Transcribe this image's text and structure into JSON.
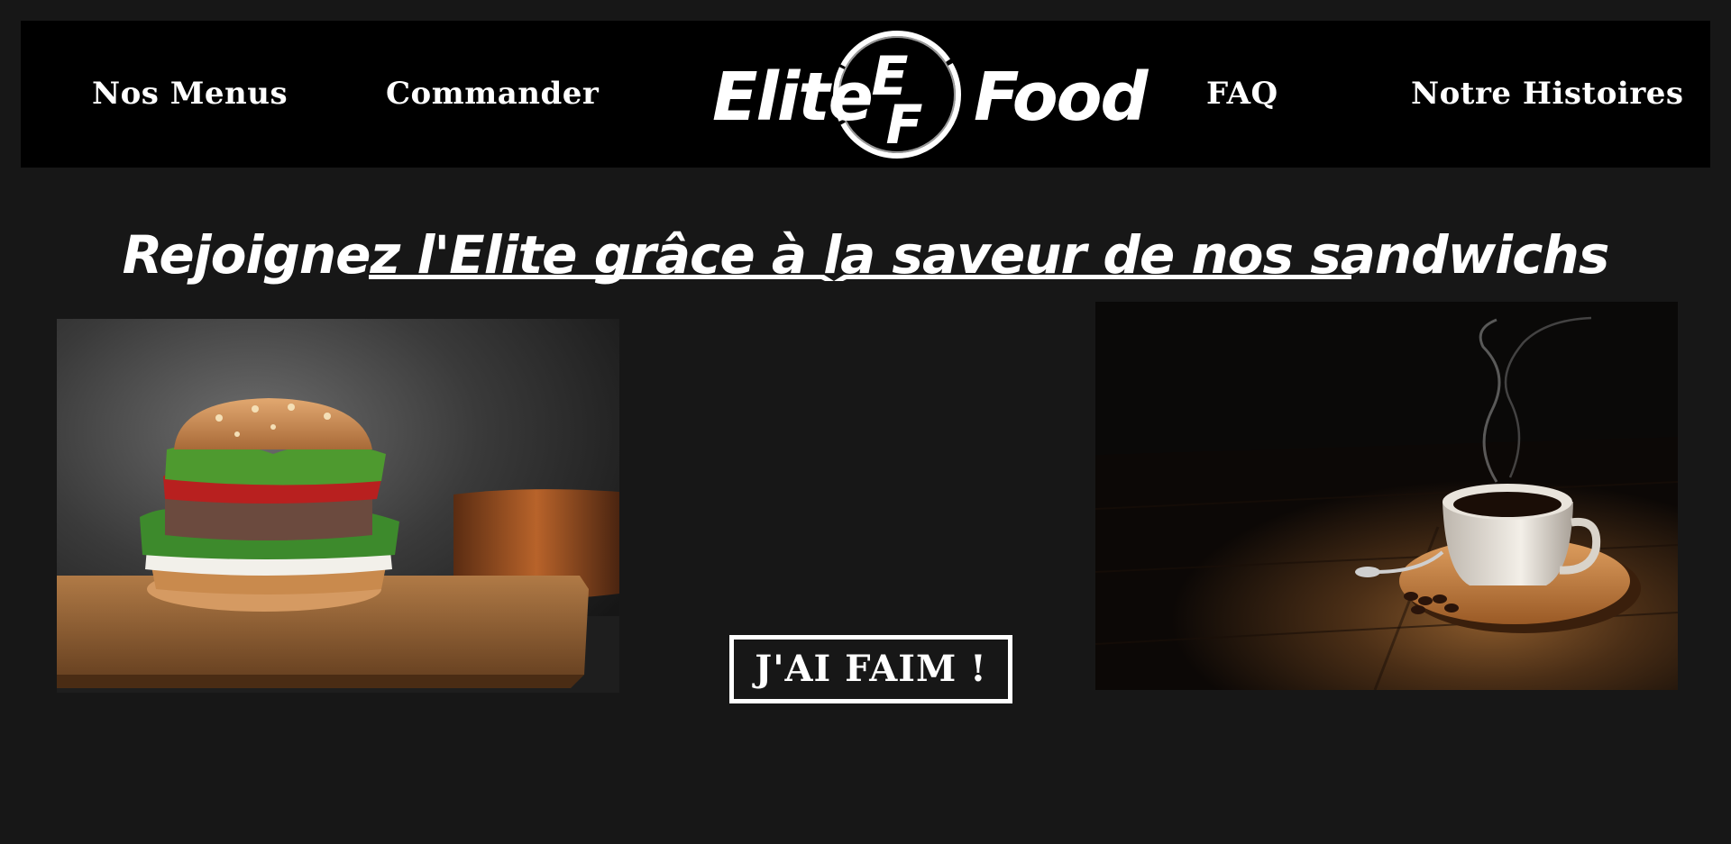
{
  "nav": {
    "items": [
      {
        "label": "Nos Menus"
      },
      {
        "label": "Commander"
      },
      {
        "label": "FAQ"
      },
      {
        "label": "Notre Histoires"
      }
    ]
  },
  "logo": {
    "word_left": "Elite",
    "word_right": "Food",
    "monogram_top": "E",
    "monogram_bottom": "F"
  },
  "hero": {
    "headline": "Rejoignez l'Elite grâce à la saveur de nos sandwichs",
    "cta_label": "J'AI FAIM !"
  },
  "images": {
    "left": "burger-photo",
    "right": "coffee-cup-photo"
  },
  "colors": {
    "page_background": "#171717",
    "navbar_background": "#000000",
    "text": "#ffffff"
  }
}
